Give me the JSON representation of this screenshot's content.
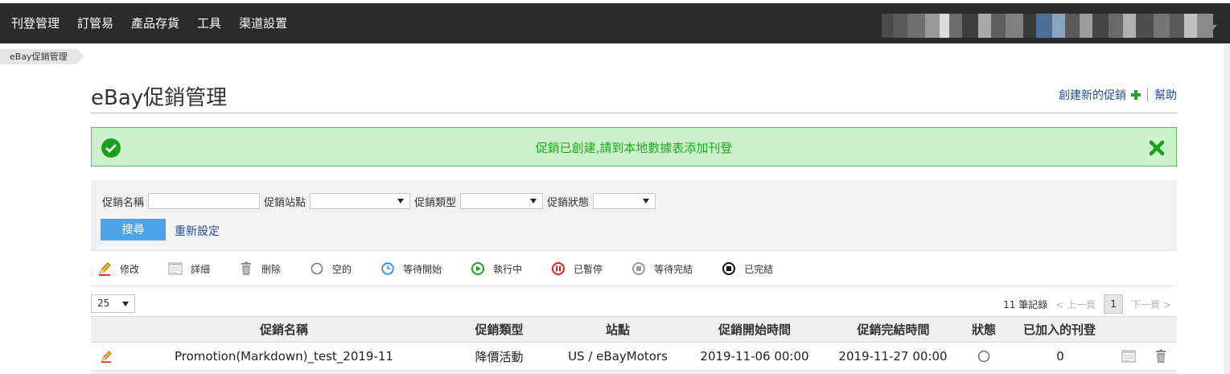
{
  "nav": {
    "items": [
      "刊登管理",
      "訂管易",
      "產品存貨",
      "工具",
      "渠道設置"
    ]
  },
  "breadcrumb": "eBay促銷管理",
  "page": {
    "title": "eBay促銷管理",
    "create_label": "創建新的促銷",
    "help_label": "幫助"
  },
  "alert": {
    "message": "促銷已創建,請到本地數據表添加刊登"
  },
  "filter": {
    "name_label": "促銷名稱",
    "name_value": "",
    "site_label": "促銷站點",
    "site_value": "",
    "type_label": "促銷類型",
    "type_value": "",
    "status_label": "促銷狀態",
    "status_value": "",
    "search_label": "搜尋",
    "reset_label": "重新設定"
  },
  "legend": [
    {
      "label": "修改",
      "icon": "pencil-icon"
    },
    {
      "label": "詳細",
      "icon": "details-icon"
    },
    {
      "label": "刪除",
      "icon": "trash-icon"
    },
    {
      "label": "空的",
      "icon": "status-empty-icon"
    },
    {
      "label": "等待開始",
      "icon": "clock-icon"
    },
    {
      "label": "執行中",
      "icon": "play-icon"
    },
    {
      "label": "已暫停",
      "icon": "pause-icon"
    },
    {
      "label": "等待完結",
      "icon": "stop-grey-icon"
    },
    {
      "label": "已完結",
      "icon": "stop-black-icon"
    }
  ],
  "pagination": {
    "page_size": "25",
    "records": "11 筆記錄",
    "prev": "< 上一頁",
    "current": "1",
    "next": "下一頁 >"
  },
  "table": {
    "headers": [
      "促銷名稱",
      "促銷類型",
      "站點",
      "促銷開始時間",
      "促銷完結時間",
      "狀態",
      "已加入的刊登"
    ],
    "rows": [
      {
        "name": "Promotion(Markdown)_test_2019-11",
        "type": "降價活動",
        "site": "US / eBayMotors",
        "start": "2019-11-06 00:00",
        "end": "2019-11-27 00:00",
        "status_icon": "status-empty-icon",
        "listings": "0"
      }
    ]
  },
  "colors": {
    "nav_bg": "#2b2b2b",
    "link": "#1f4e99",
    "success_bg": "#ccf2cc",
    "success_text": "#1fa81f",
    "button": "#4da3e6"
  }
}
